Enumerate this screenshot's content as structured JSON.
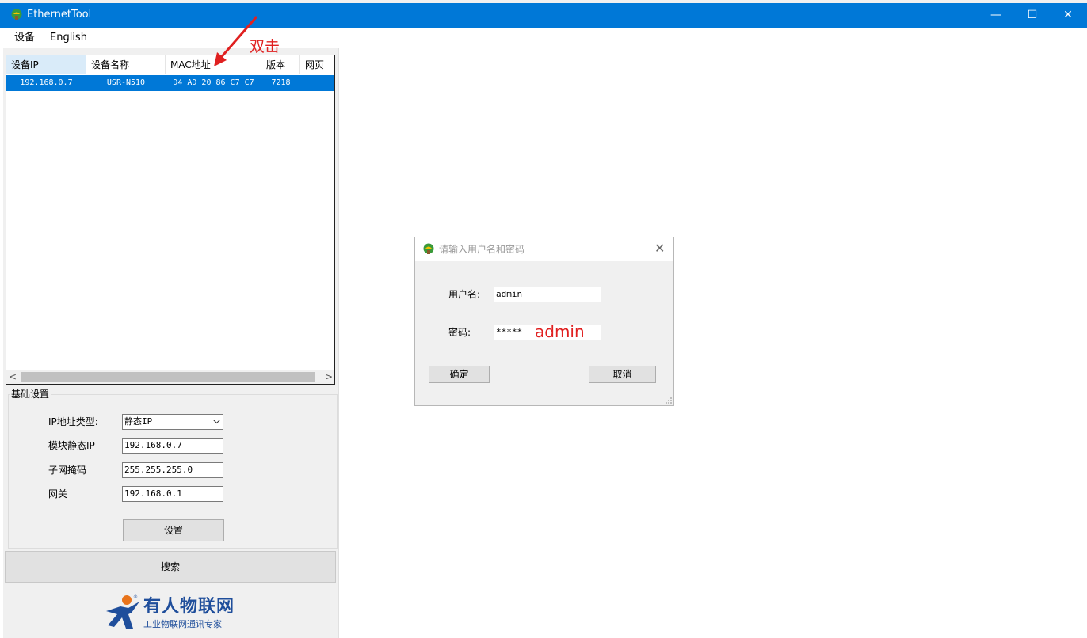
{
  "window": {
    "title": "EthernetTool",
    "minimize_glyph": "—",
    "maximize_glyph": "☐",
    "close_glyph": "✕"
  },
  "menu": {
    "items": [
      "设备",
      "English"
    ]
  },
  "device_list": {
    "columns": [
      "设备IP",
      "设备名称",
      "MAC地址",
      "版本",
      "网页"
    ],
    "rows": [
      [
        "192.168.0.7",
        "USR-N510",
        "D4 AD 20 86 C7 C7",
        "7218",
        ""
      ]
    ],
    "scroll_left": "<",
    "scroll_right": ">"
  },
  "basic_settings": {
    "title": "基础设置",
    "ip_type_label": "IP地址类型:",
    "ip_type_value": "静态IP",
    "static_ip_label": "模块静态IP",
    "static_ip_value": "192.168.0.7",
    "subnet_label": "子网掩码",
    "subnet_value": "255.255.255.0",
    "gateway_label": "网关",
    "gateway_value": "192.168.0.1",
    "set_button": "设置"
  },
  "search_button": "搜索",
  "logo": {
    "name": "有人物联网",
    "tagline": "工业物联网通讯专家"
  },
  "login_dialog": {
    "title": "请输入用户名和密码",
    "close_glyph": "✕",
    "username_label": "用户名:",
    "username_value": "admin",
    "password_label": "密码:",
    "password_value": "*****",
    "ok_button": "确定",
    "cancel_button": "取消"
  },
  "annotations": {
    "double_click": "双击",
    "password_hint": "admin"
  },
  "colors": {
    "title_bar": "#0078d7",
    "selection": "#0078d7",
    "annotation": "#e02020",
    "logo": "#1f4e9b"
  }
}
